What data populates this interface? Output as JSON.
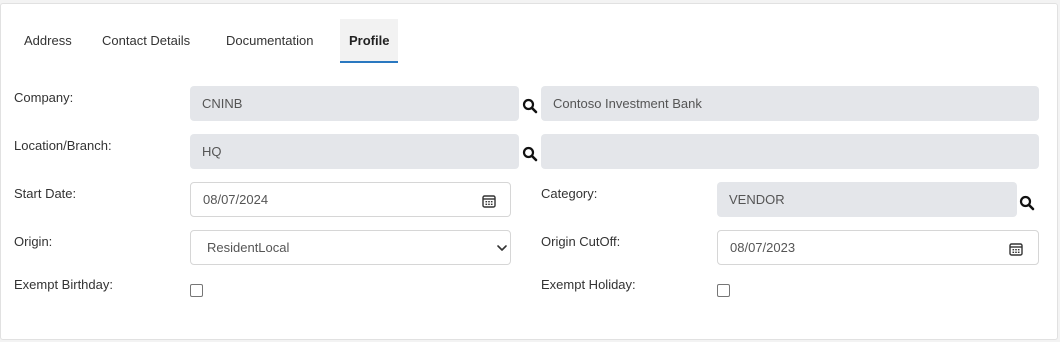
{
  "tabs": [
    {
      "label": "Address"
    },
    {
      "label": "Contact Details"
    },
    {
      "label": "Documentation"
    },
    {
      "label": "Profile",
      "active": true
    }
  ],
  "form": {
    "company": {
      "label": "Company:",
      "code": "CNINB",
      "name": "Contoso Investment Bank"
    },
    "location": {
      "label": "Location/Branch:",
      "code": "HQ",
      "name": ""
    },
    "start_date": {
      "label": "Start Date:",
      "value": "08/07/2024"
    },
    "category": {
      "label": "Category:",
      "value": "VENDOR"
    },
    "origin": {
      "label": "Origin:",
      "value": "ResidentLocal"
    },
    "origin_cutoff": {
      "label": "Origin CutOff:",
      "value": "08/07/2023"
    },
    "exempt_birthday": {
      "label": "Exempt Birthday:",
      "checked": false
    },
    "exempt_holiday": {
      "label": "Exempt Holiday:",
      "checked": false
    }
  },
  "icons": {
    "search": "search-icon",
    "calendar": "calendar-icon",
    "dropdown": "chevron-down-icon"
  },
  "colors": {
    "accent": "#2a78c0",
    "readonly_bg": "#e4e6ea",
    "active_tab_bg": "#f2f2f2"
  }
}
